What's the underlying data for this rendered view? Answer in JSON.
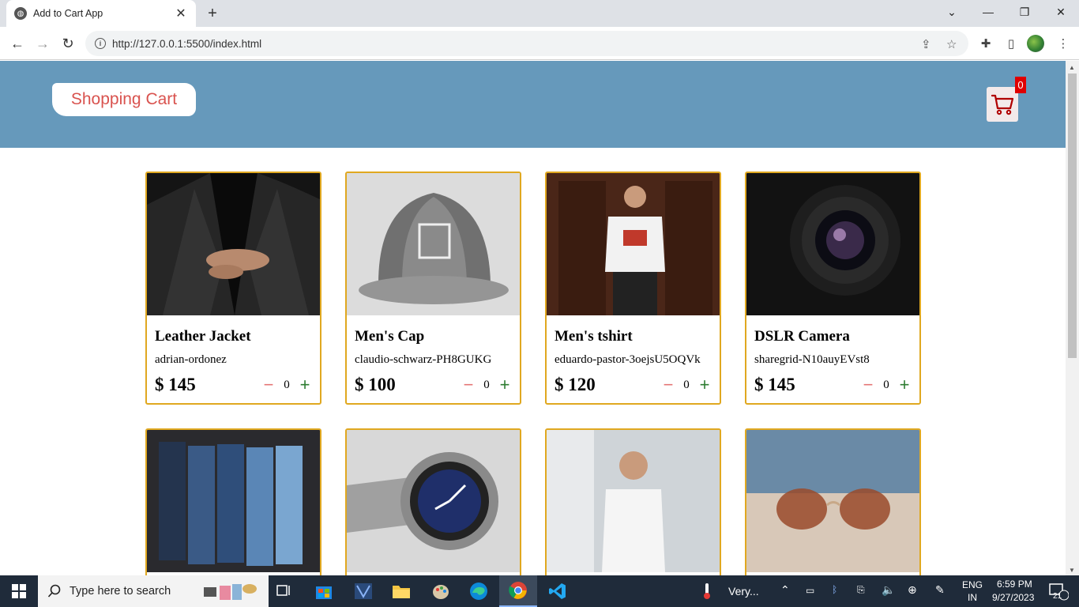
{
  "browser": {
    "tab_title": "Add to Cart App",
    "url": "http://127.0.0.1:5500/index.html"
  },
  "page": {
    "logo_text": "Shopping Cart",
    "cart_count": "0"
  },
  "products": [
    {
      "name": "Leather Jacket",
      "credit": "adrian-ordonez",
      "price": "$ 145",
      "qty": "0"
    },
    {
      "name": "Men's Cap",
      "credit": "claudio-schwarz-PH8GUKG",
      "price": "$ 100",
      "qty": "0"
    },
    {
      "name": "Men's tshirt",
      "credit": "eduardo-pastor-3oejsU5OQVk",
      "price": "$ 120",
      "qty": "0"
    },
    {
      "name": "DSLR Camera",
      "credit": "sharegrid-N10auyEVst8",
      "price": "$ 145",
      "qty": "0"
    }
  ],
  "taskbar": {
    "search_placeholder": "Type here to search",
    "weather": "Very...",
    "lang_1": "ENG",
    "lang_2": "IN",
    "time": "6:59 PM",
    "date": "9/27/2023",
    "notifications": "21"
  },
  "colors": {
    "header_bg": "#6699bb",
    "card_border": "#e0a820",
    "logo_text": "#d9534f",
    "badge": "#e00000"
  }
}
